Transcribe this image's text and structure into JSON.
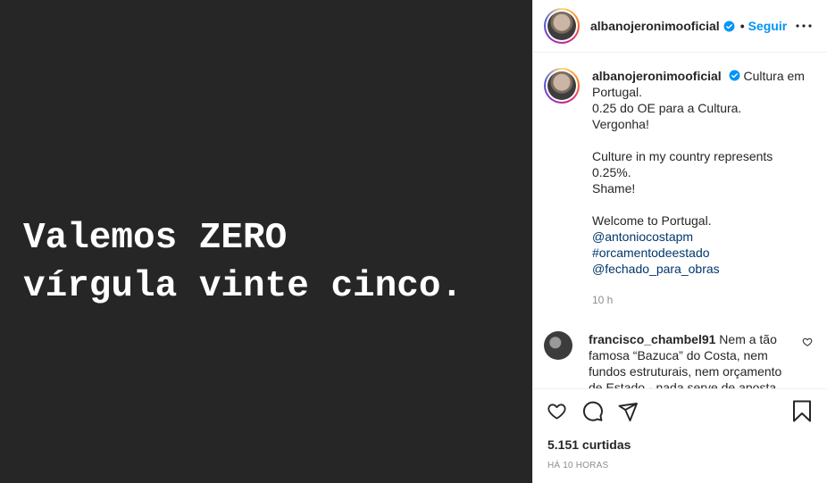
{
  "post": {
    "image_text": "Valemos ZERO\nvírgula vinte cinco."
  },
  "header": {
    "username": "albanojeronimooficial",
    "separator": "•",
    "follow_label": "Seguir"
  },
  "caption": {
    "username": "albanojeronimooficial",
    "first_line": "Cultura em Portugal.",
    "lines": [
      "0.25 do OE para a Cultura.",
      "Vergonha!"
    ],
    "lines_en": [
      "Culture in my country represents 0.25%.",
      "Shame!"
    ],
    "welcome": "Welcome to Portugal.",
    "tags": [
      "@antoniocostapm",
      "#orcamentodeestado",
      "@fechado_para_obras"
    ],
    "time": "10 h"
  },
  "comment": {
    "username": "francisco_chambel91",
    "text": "Nem a tão famosa “Bazuca” do Costa, nem fundos estruturais, nem orçamento de Estado - nada serve de aposta na Cultura! É uma lixeira cultural"
  },
  "footer": {
    "likes": "5.151 curtidas",
    "posted": "HÁ 10 HORAS"
  },
  "icons": {
    "verified": "verified-badge-icon",
    "more": "more-horizontal-icon",
    "like": "heart-icon",
    "comment": "comment-icon",
    "share": "share-icon",
    "save": "bookmark-icon"
  },
  "colors": {
    "media_bg": "#262626",
    "follow": "#0095f6",
    "link": "#00376b",
    "muted": "#8e8e8e"
  }
}
